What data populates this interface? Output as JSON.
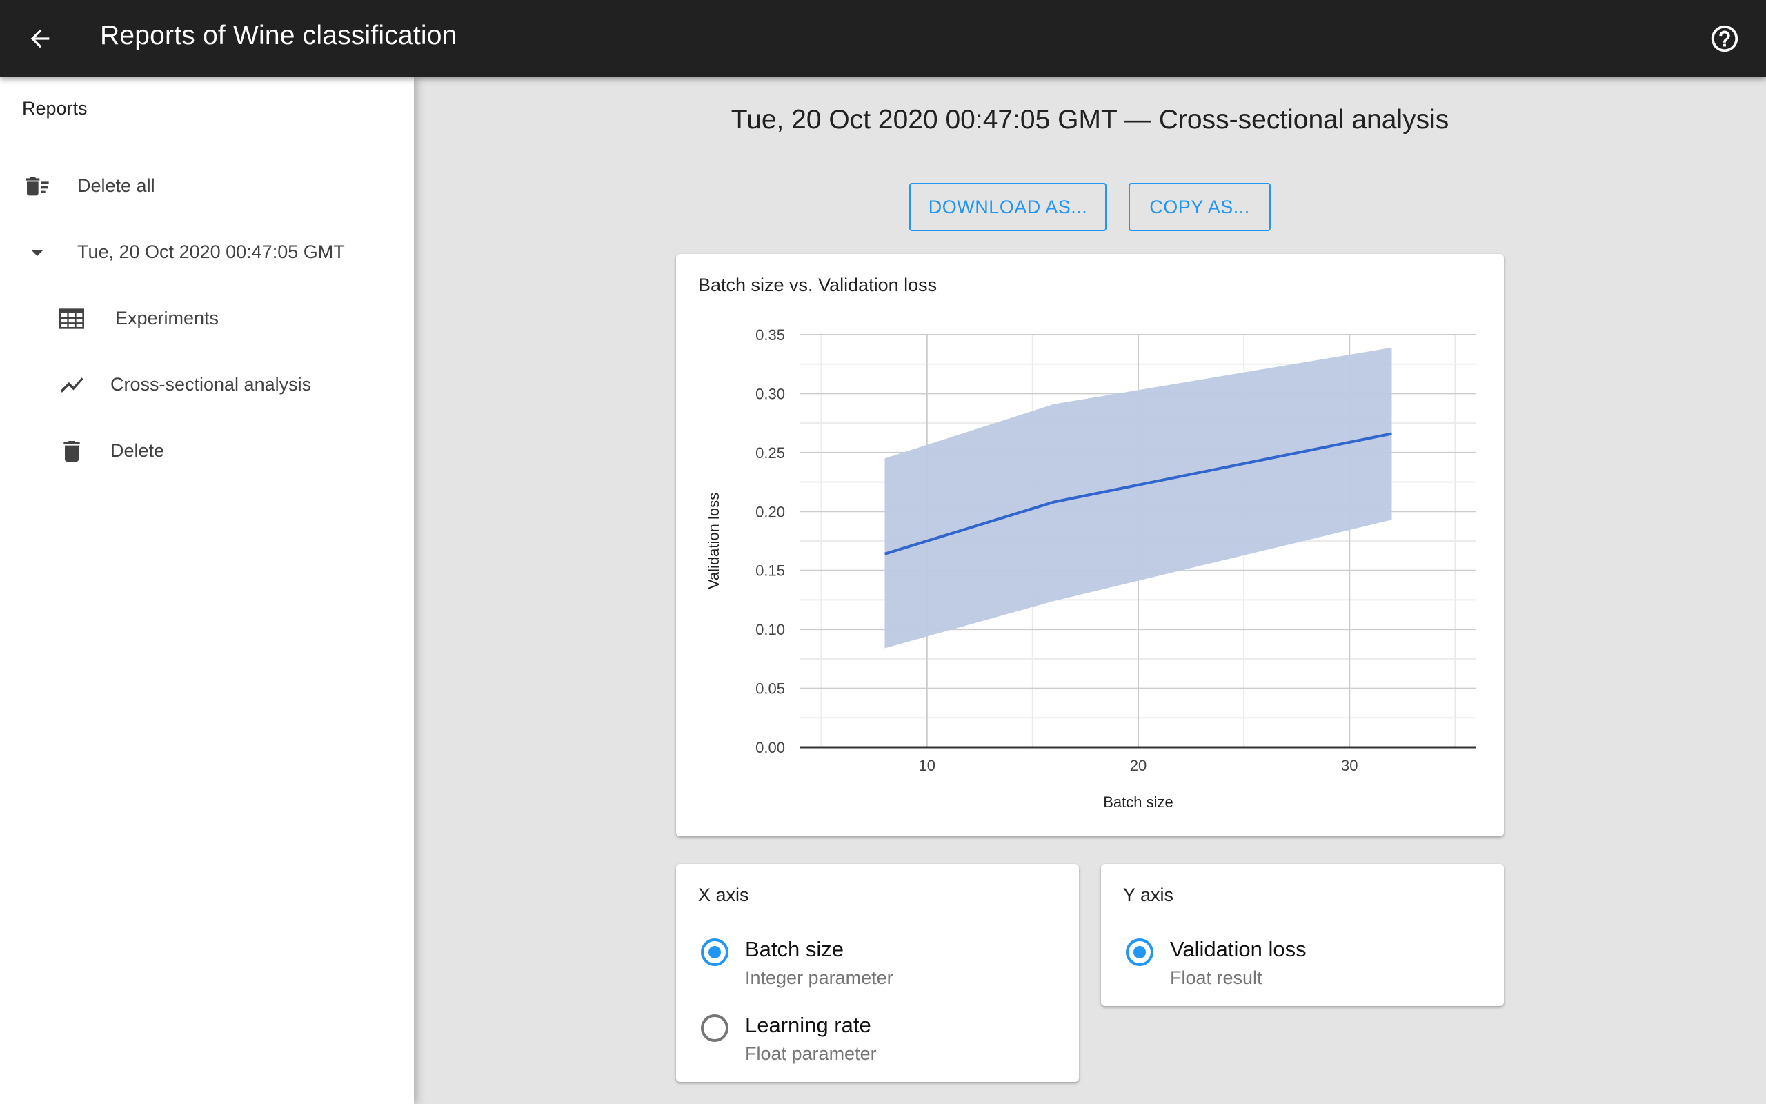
{
  "appbar": {
    "title": "Reports of Wine classification",
    "back_icon": "arrow-back-icon",
    "help_icon": "help-circle-icon"
  },
  "sidebar": {
    "header": "Reports",
    "items": [
      {
        "label": "Delete all",
        "icon": "delete-sweep-icon"
      },
      {
        "label": "Tue, 20 Oct 2020 00:47:05 GMT",
        "icon": "arrow-drop-down-icon"
      },
      {
        "label": "Experiments",
        "icon": "table-icon"
      },
      {
        "label": "Cross-sectional analysis",
        "icon": "show-chart-icon"
      },
      {
        "label": "Delete",
        "icon": "delete-icon"
      }
    ]
  },
  "main": {
    "heading": "Tue, 20 Oct 2020 00:47:05 GMT — Cross-sectional analysis",
    "download_label": "DOWNLOAD AS...",
    "copy_label": "COPY AS..."
  },
  "colors": {
    "accent": "#2196f3",
    "appbar": "#212121",
    "line": "#3366cc",
    "band": "#bcc9e1"
  },
  "chart_data": {
    "type": "line",
    "title": "Batch size vs. Validation loss",
    "xlabel": "Batch size",
    "ylabel": "Validation loss",
    "xlim": [
      4,
      36
    ],
    "ylim": [
      0,
      0.35
    ],
    "xticks": [
      10,
      20,
      30
    ],
    "xtick_labels": [
      "10",
      "20",
      "30"
    ],
    "yticks": [
      0,
      0.05,
      0.1,
      0.15,
      0.2,
      0.25,
      0.3,
      0.35
    ],
    "ytick_labels": [
      "0.00",
      "0.05",
      "0.10",
      "0.15",
      "0.20",
      "0.25",
      "0.30",
      "0.35"
    ],
    "grid": true,
    "legend": "none",
    "series": [
      {
        "name": "Validation loss",
        "x": [
          8,
          16,
          32
        ],
        "y": [
          0.164,
          0.208,
          0.266
        ],
        "lower": [
          0.084,
          0.124,
          0.193
        ],
        "upper": [
          0.245,
          0.291,
          0.339
        ]
      }
    ]
  },
  "x_axis_panel": {
    "title": "X axis",
    "options": [
      {
        "label": "Batch size",
        "sub": "Integer parameter",
        "checked": true
      },
      {
        "label": "Learning rate",
        "sub": "Float parameter",
        "checked": false
      }
    ]
  },
  "y_axis_panel": {
    "title": "Y axis",
    "options": [
      {
        "label": "Validation loss",
        "sub": "Float result",
        "checked": true
      }
    ]
  }
}
